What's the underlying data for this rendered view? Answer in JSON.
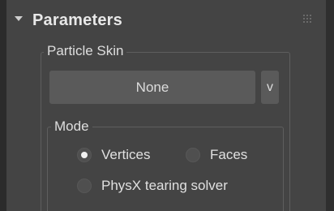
{
  "rollout": {
    "title": "Parameters"
  },
  "particle_skin": {
    "group_label": "Particle Skin",
    "picker_value": "None",
    "dropdown_label": "v"
  },
  "mode": {
    "group_label": "Mode",
    "options": [
      {
        "label": "Vertices",
        "selected": true
      },
      {
        "label": "Faces",
        "selected": false
      },
      {
        "label": "PhysX tearing solver",
        "selected": false
      }
    ]
  },
  "colors": {
    "panel_bg": "#444444",
    "button_bg": "#5a5a5a",
    "text": "#dcdcdc"
  }
}
